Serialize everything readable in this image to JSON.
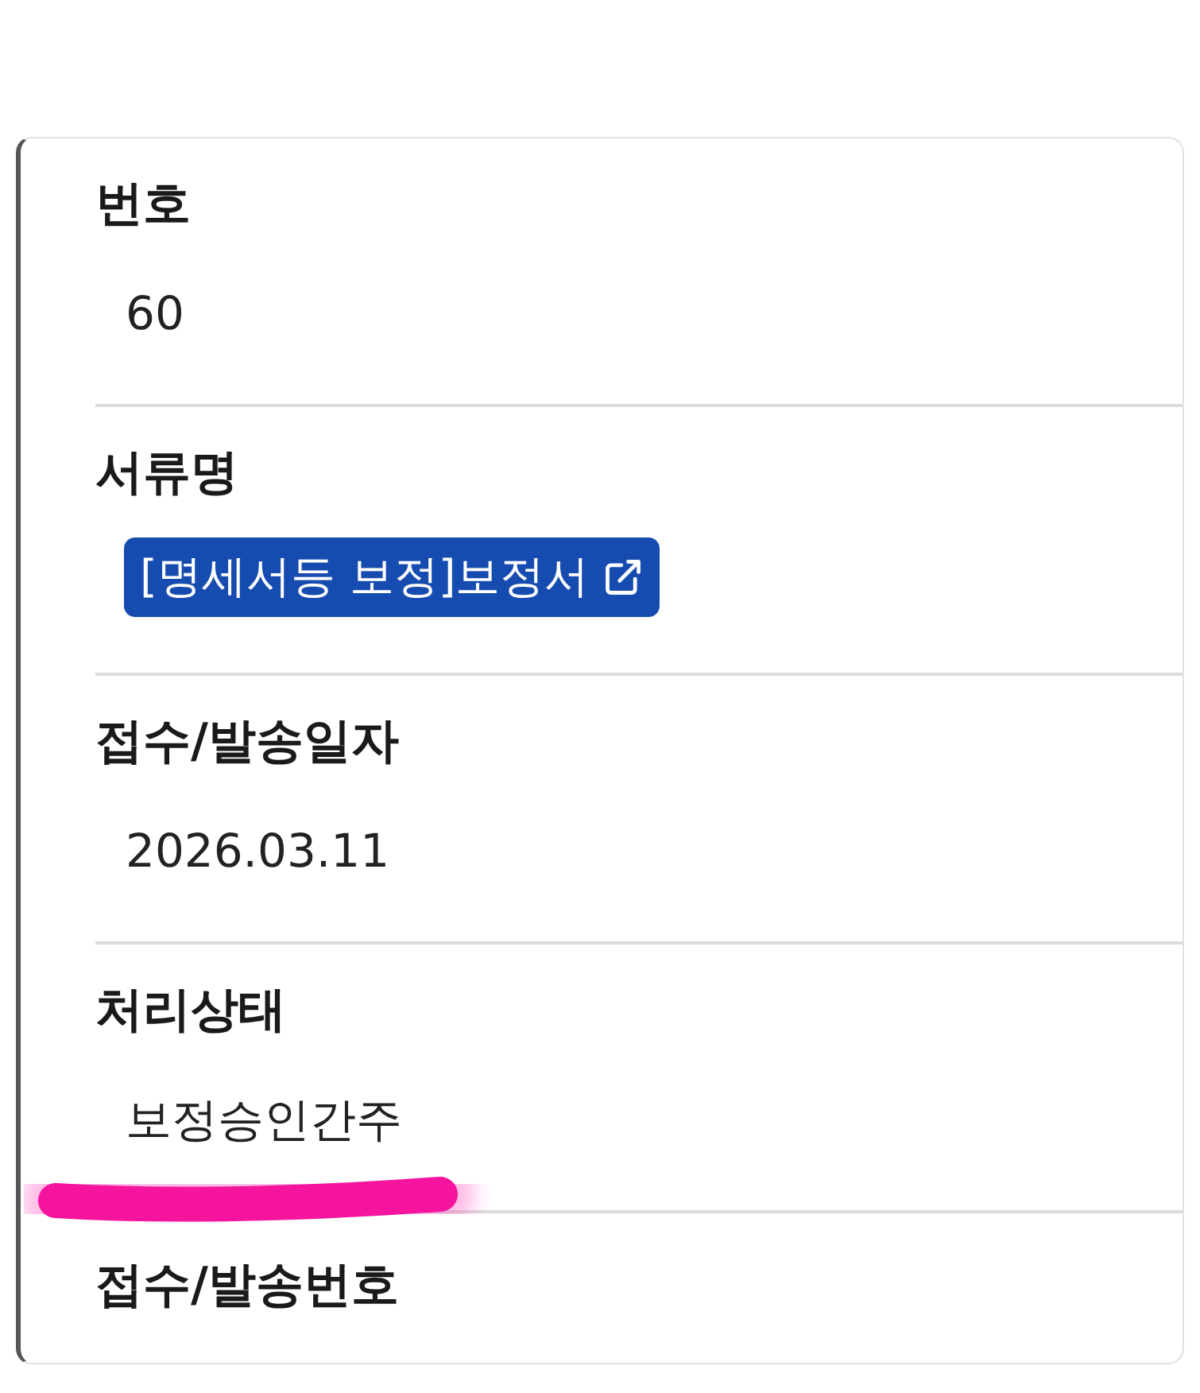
{
  "fields": [
    {
      "label": "번호",
      "value": "60",
      "kind": "text"
    },
    {
      "label": "서류명",
      "value": "[명세서등 보정]보정서",
      "kind": "link"
    },
    {
      "label": "접수/발송일자",
      "value": "2026.03.11",
      "kind": "text"
    },
    {
      "label": "처리상태",
      "value": "보정승인간주",
      "kind": "text"
    },
    {
      "label": "접수/발송번호"
    }
  ]
}
